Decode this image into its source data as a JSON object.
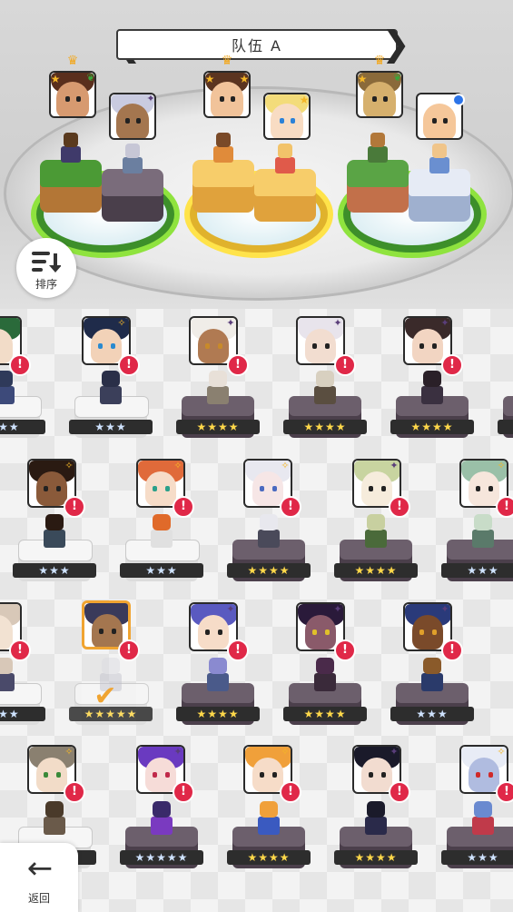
{
  "team": {
    "title": "队伍 A"
  },
  "sort": {
    "label": "排序"
  },
  "back": {
    "label": "返回"
  },
  "colors": {
    "alert": "#e02848",
    "selected": "#f0a431",
    "green_base": "#8fe33e",
    "yellow_base": "#ffe34a"
  },
  "roster_rows": [
    {
      "slots": [
        {
          "stars": "★★★",
          "style": "light"
        },
        {
          "stars": "★★★",
          "style": "light"
        },
        {
          "stars": "★★★★",
          "style": "dark"
        },
        {
          "stars": "★★★★",
          "style": "dark"
        },
        {
          "stars": "★★★★",
          "style": "dark"
        },
        {
          "stars": "★★★",
          "style": "dark"
        }
      ]
    },
    {
      "slots": [
        {
          "stars": "★★★",
          "style": "light"
        },
        {
          "stars": "★★★",
          "style": "light"
        },
        {
          "stars": "★★★★",
          "style": "dark"
        },
        {
          "stars": "★★★★",
          "style": "dark"
        },
        {
          "stars": "★★★",
          "style": "dark"
        }
      ]
    },
    {
      "slots": [
        {
          "stars": "★★★",
          "style": "light"
        },
        {
          "stars": "★★★★★",
          "style": "light"
        },
        {
          "stars": "★★★★",
          "style": "dark"
        },
        {
          "stars": "★★★★",
          "style": "dark"
        },
        {
          "stars": "★★★",
          "style": "dark"
        }
      ]
    },
    {
      "slots": [
        {
          "stars": "★★★",
          "style": "light"
        },
        {
          "stars": "★★★★★",
          "style": "dark"
        },
        {
          "stars": "★★★★",
          "style": "dark"
        },
        {
          "stars": "★★★★",
          "style": "dark"
        },
        {
          "stars": "★★★",
          "style": "dark"
        }
      ]
    }
  ]
}
